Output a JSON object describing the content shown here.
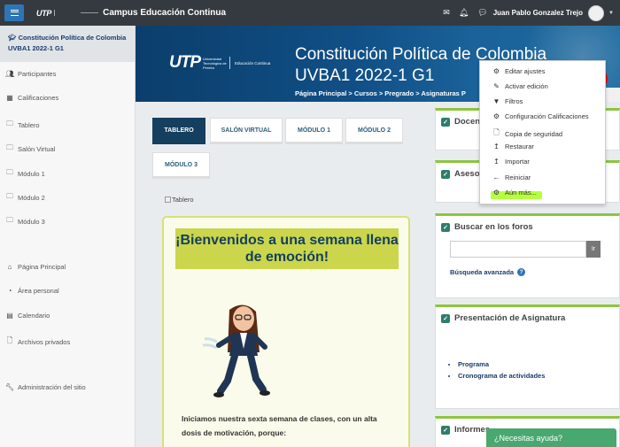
{
  "navbar": {
    "logo_text": "UTP",
    "site_name": "Campus Educación Continua",
    "user_name": "Juan Pablo Gonzalez Trejo"
  },
  "sidebar": {
    "course_title": "Constitución Política de Colombia UVBA1 2022-1 G1",
    "items": [
      {
        "label": "Participantes",
        "icon": "users-icon"
      },
      {
        "label": "Calificaciones",
        "icon": "table-icon"
      },
      {
        "label": "Tablero",
        "icon": "folder-icon"
      },
      {
        "label": "Salón Virtual",
        "icon": "folder-icon"
      },
      {
        "label": "Módulo 1",
        "icon": "folder-icon"
      },
      {
        "label": "Módulo 2",
        "icon": "folder-icon"
      },
      {
        "label": "Módulo 3",
        "icon": "folder-icon"
      },
      {
        "label": "Página Principal",
        "icon": "home-icon"
      },
      {
        "label": "Área personal",
        "icon": "dashboard-icon"
      },
      {
        "label": "Calendario",
        "icon": "calendar-icon"
      },
      {
        "label": "Archivos privados",
        "icon": "file-icon"
      },
      {
        "label": "Administración del sitio",
        "icon": "wrench-icon"
      }
    ]
  },
  "banner": {
    "logo_text": "UTP",
    "logo_sub": "Universidad Tecnológica de Pereira",
    "logo_sub2": "Educación Continua",
    "title_line1": "Constitución Política de Colombia",
    "title_line2": "UVBA1 2022-1 G1",
    "breadcrumb": "Página Principal  >  Cursos  >  Pregrado  >  Asignaturas P"
  },
  "tabs": [
    "TABLERO",
    "SALÓN VIRTUAL",
    "MÓDULO 1",
    "MÓDULO 2",
    "MÓDULO 3"
  ],
  "main": {
    "image_alt": "Tablero",
    "welcome_title": "¡Bienvenidos a una semana llena de emoción!",
    "welcome_text": "Iniciamos nuestra sexta semana de clases, con un alta dosis de motivación, porque:"
  },
  "blocks": {
    "docentes": "Docent",
    "asesor": "Asesor",
    "foros_title": "Buscar en los foros",
    "search_button": "Ir",
    "advanced_search": "Búsqueda avanzada",
    "presentacion_title": "Presentación de Asignatura",
    "presentacion_items": [
      "Programa",
      "Cronograma de actividades"
    ],
    "informes": "Informes"
  },
  "dropdown": {
    "items": [
      {
        "label": "Editar ajustes",
        "icon": "gear-icon"
      },
      {
        "label": "Activar edición",
        "icon": "pencil-icon"
      },
      {
        "label": "Filtros",
        "icon": "filter-icon"
      },
      {
        "label": "Configuración Calificaciones",
        "icon": "gear-icon"
      },
      {
        "label": "Copia de seguridad",
        "icon": "file-icon"
      },
      {
        "label": "Restaurar",
        "icon": "upload-icon"
      },
      {
        "label": "Importar",
        "icon": "upload-icon"
      },
      {
        "label": "Reiniciar",
        "icon": "arrow-left-icon"
      },
      {
        "label": "Aún más...",
        "icon": "gear-icon"
      }
    ]
  },
  "help_button": "¿Necesitas ayuda?",
  "colors": {
    "navbar": "#343a40",
    "banner": "#104f86",
    "accent_green": "#8cc63f",
    "tab_active": "#143f5f",
    "welcome_title_bg": "#cbd64c",
    "help_button": "#49a870"
  }
}
